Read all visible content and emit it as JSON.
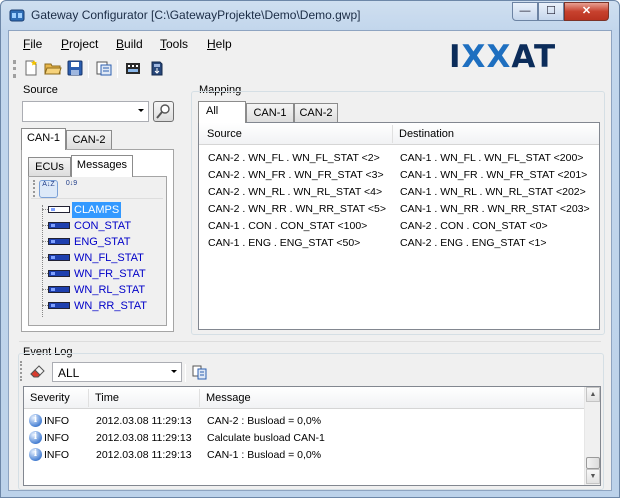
{
  "window": {
    "title": "Gateway Configurator [C:\\GatewayProjekte\\Demo\\Demo.gwp]",
    "minimize": "—",
    "maximize": "☐",
    "close": "✕"
  },
  "menu": {
    "file": "F",
    "file_rest": "ile",
    "project": "P",
    "project_rest": "roject",
    "build": "B",
    "build_rest": "uild",
    "tools": "T",
    "tools_rest": "ools",
    "help": "H",
    "help_rest": "elp"
  },
  "toolbar": {
    "icons": [
      "new-document-icon",
      "open-folder-icon",
      "save-disk-icon",
      "export-icon",
      "compile-icon",
      "download-icon"
    ]
  },
  "logo": {
    "part1": "I",
    "part2": "XX",
    "part3": "AT"
  },
  "source": {
    "label": "Source",
    "combo_value": "",
    "can_tabs": [
      "CAN-1",
      "CAN-2"
    ],
    "inner_tabs": [
      "ECUs",
      "Messages"
    ],
    "sort_az": "A↓Z",
    "sort_09": "0↓9",
    "messages": [
      "CLAMPS",
      "CON_STAT",
      "ENG_STAT",
      "WN_FL_STAT",
      "WN_FR_STAT",
      "WN_RL_STAT",
      "WN_RR_STAT"
    ]
  },
  "mapping": {
    "label": "Mapping",
    "tabs": [
      "All",
      "CAN-1",
      "CAN-2"
    ],
    "columns": {
      "source": "Source",
      "destination": "Destination"
    },
    "rows": [
      {
        "source": "CAN-2 . WN_FL . WN_FL_STAT <2>",
        "destination": "CAN-1 . WN_FL . WN_FL_STAT <200>"
      },
      {
        "source": "CAN-2 . WN_FR . WN_FR_STAT <3>",
        "destination": "CAN-1 . WN_FR . WN_FR_STAT <201>"
      },
      {
        "source": "CAN-2 . WN_RL . WN_RL_STAT <4>",
        "destination": "CAN-1 . WN_RL . WN_RL_STAT <202>"
      },
      {
        "source": "CAN-2 . WN_RR . WN_RR_STAT <5>",
        "destination": "CAN-1 . WN_RR . WN_RR_STAT <203>"
      },
      {
        "source": "CAN-1 . CON . CON_STAT <100>",
        "destination": "CAN-2 . CON . CON_STAT <0>"
      },
      {
        "source": "CAN-1 . ENG . ENG_STAT <50>",
        "destination": "CAN-2 . ENG . ENG_STAT <1>"
      }
    ]
  },
  "event_log": {
    "label": "Event Log",
    "filter_value": "ALL",
    "columns": {
      "severity": "Severity",
      "time": "Time",
      "message": "Message"
    },
    "rows": [
      {
        "severity": "INFO",
        "time": "2012.03.08 11:29:13",
        "message": "CAN-2 : Busload = 0,0%"
      },
      {
        "severity": "INFO",
        "time": "2012.03.08 11:29:13",
        "message": "Calculate busload CAN-1"
      },
      {
        "severity": "INFO",
        "time": "2012.03.08 11:29:13",
        "message": "CAN-1 : Busload = 0,0%"
      }
    ]
  }
}
